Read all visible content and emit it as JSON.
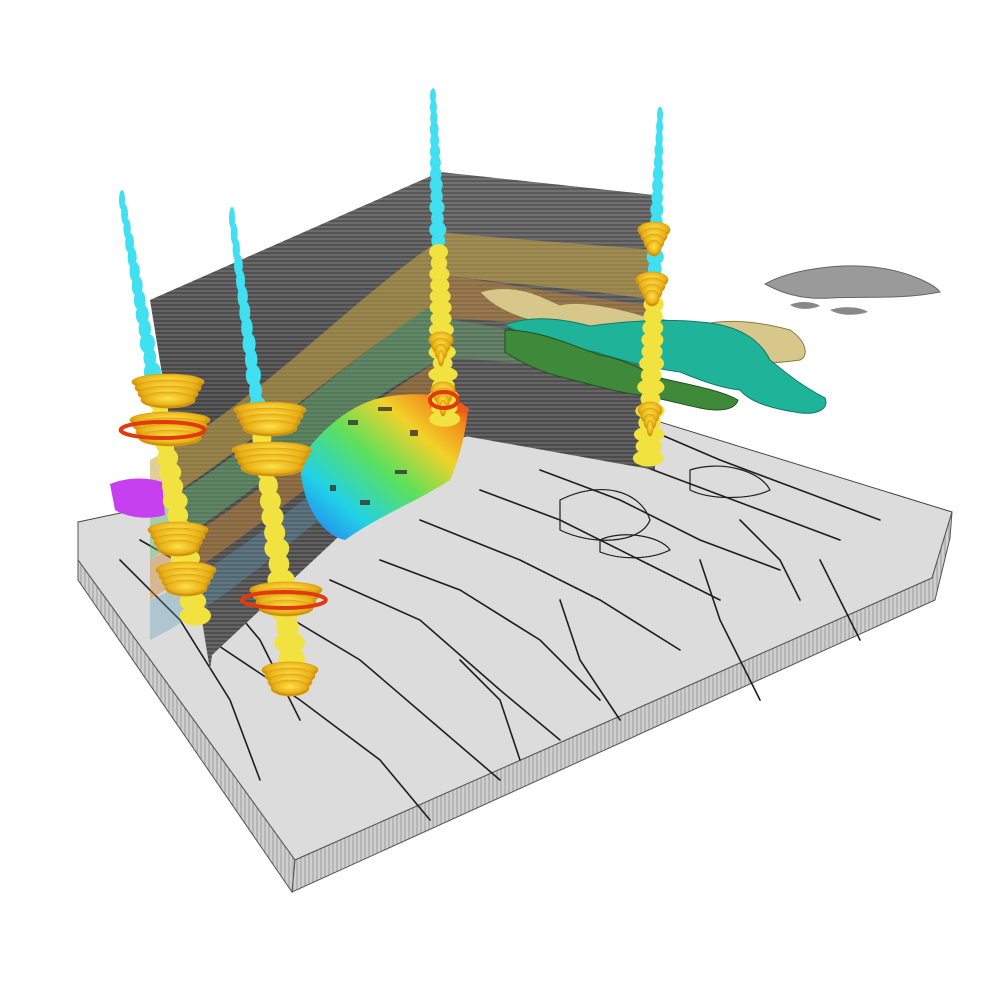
{
  "scene": {
    "objects": [
      {
        "name": "seismic-slab",
        "kind": "seismic-variance-cube",
        "fill": "#d9d9d9",
        "stroke": "#1a1a1a"
      },
      {
        "name": "seismic-wall-left",
        "kind": "seismic-inline-section",
        "fill": "#5a5a5a"
      },
      {
        "name": "seismic-wall-right",
        "kind": "seismic-crossline-section",
        "fill": "#5d5d5d"
      },
      {
        "name": "horizon-surface-rainbow",
        "kind": "attribute-horizon",
        "colors": [
          "#2a6cf2",
          "#20d2e6",
          "#5ee05a",
          "#f2d22a",
          "#f28a1a",
          "#e02a14"
        ]
      },
      {
        "name": "magenta-body",
        "kind": "geobody",
        "color": "#c640f0"
      },
      {
        "name": "green-geobody",
        "kind": "geobody",
        "color": "#3f8a3a"
      },
      {
        "name": "teal-geobody",
        "kind": "geobody",
        "color": "#1fb39a"
      },
      {
        "name": "tan-geobody",
        "kind": "geobody",
        "color": "#d8c78a"
      },
      {
        "name": "gray-fragments",
        "kind": "geobody",
        "color": "#9a9a9a"
      },
      {
        "name": "well-1",
        "kind": "well-log",
        "colors": [
          "#40e0f0",
          "#f2e240",
          "#e0a010",
          "#e03a10"
        ]
      },
      {
        "name": "well-2",
        "kind": "well-log",
        "colors": [
          "#40e0f0",
          "#f2e240",
          "#e0a010",
          "#e03a10"
        ]
      },
      {
        "name": "well-3",
        "kind": "well-log",
        "colors": [
          "#40e0f0",
          "#f2e240",
          "#e0a010",
          "#e03a10"
        ]
      },
      {
        "name": "well-4",
        "kind": "well-log",
        "colors": [
          "#40e0f0",
          "#f2e240",
          "#e0a010",
          "#e03a10"
        ]
      }
    ]
  }
}
